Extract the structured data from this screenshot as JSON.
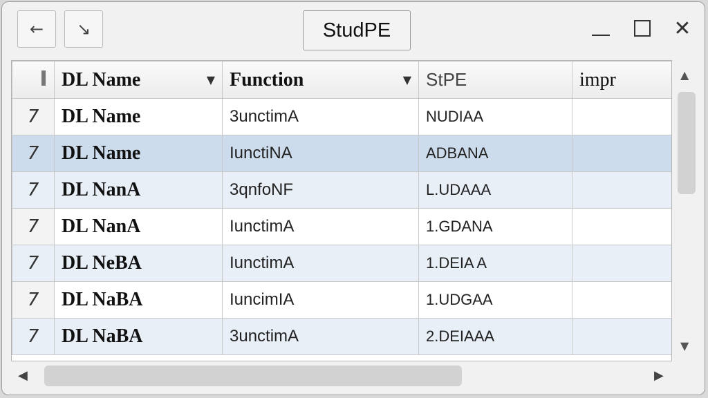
{
  "window": {
    "title": "StudPE",
    "back_glyph": "←",
    "down_glyph": "↘",
    "close_glyph": "✕"
  },
  "table": {
    "columns": [
      "DL Name",
      "Function",
      "StPE",
      "impr"
    ],
    "rows": [
      {
        "sel": "7",
        "name": "DL Name",
        "function": "3unctimA",
        "stud": "NUDIAA",
        "impr": ""
      },
      {
        "sel": "7",
        "name": "DL Name",
        "function": "IunctiNA",
        "stud": "ADBANA",
        "impr": ""
      },
      {
        "sel": "7",
        "name": "DL NanA",
        "function": "3qnfoNF",
        "stud": "L.UDAAA",
        "impr": ""
      },
      {
        "sel": "7",
        "name": "DL NanA",
        "function": "IunctimA",
        "stud": "1.GDANA",
        "impr": ""
      },
      {
        "sel": "7",
        "name": "DL NeBA",
        "function": "IunctimA",
        "stud": "1.DEIA A",
        "impr": ""
      },
      {
        "sel": "7",
        "name": "DL NaBA",
        "function": "IuncimIA",
        "stud": "1.UDGAA",
        "impr": ""
      },
      {
        "sel": "7",
        "name": "DL NaBA",
        "function": "3unctimA",
        "stud": "2.DEIAAA",
        "impr": ""
      }
    ]
  },
  "scroll": {
    "up": "▲",
    "down": "▼",
    "left": "◀",
    "right": "▶"
  },
  "icons": {
    "back": "back-arrow-icon",
    "restore_down": "restore-down-icon",
    "minimize": "minimize-icon",
    "maximize": "maximize-icon",
    "close": "close-icon"
  }
}
